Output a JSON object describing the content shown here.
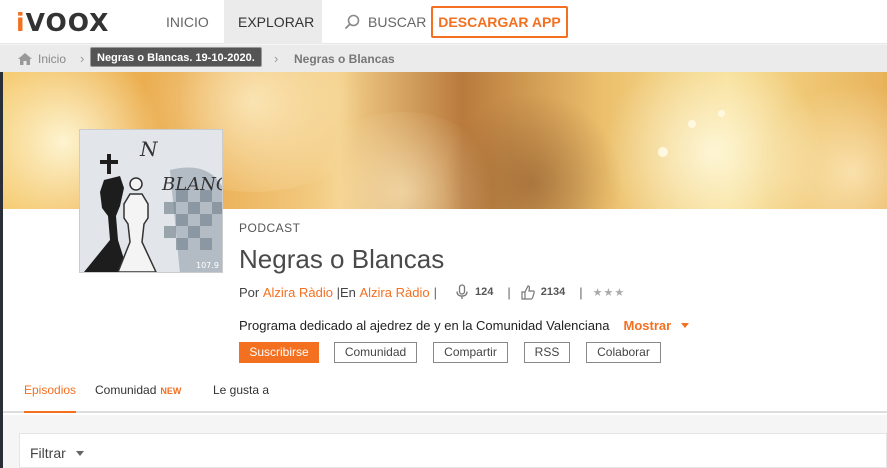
{
  "header": {
    "logo_i": "i",
    "logo_rest": "VOOX",
    "nav": [
      {
        "label": "INICIO"
      },
      {
        "label": "EXPLORAR"
      },
      {
        "label": "BUSCAR"
      }
    ],
    "download_label": "DESCARGAR APP"
  },
  "breadcrumb": {
    "home": "Inicio",
    "tooltip": "Negras o Blancas. 19-10-2020.",
    "current": "Negras o Blancas"
  },
  "podcast": {
    "tag": "PODCAST",
    "title": "Negras o Blancas",
    "by_label": "Por",
    "author": "Alzira Ràdio",
    "en_label": "|En",
    "channel": "Alzira Ràdio",
    "episodes_count": "124",
    "followers_count": "2134",
    "rating_stars": "★★★",
    "description": "Programa dedicado al ajedrez de y en la Comunidad Valenciana",
    "mostrar_label": "Mostrar"
  },
  "actions": {
    "subscribe": "Suscribirse",
    "community": "Comunidad",
    "share": "Compartir",
    "rss": "RSS",
    "collaborate": "Colaborar"
  },
  "tabs": {
    "episodes": "Episodios",
    "community": "Comunidad",
    "new_badge": "NEW",
    "likes": "Le gusta a"
  },
  "filter": {
    "label": "Filtrar"
  },
  "colors": {
    "accent": "#f37021"
  }
}
